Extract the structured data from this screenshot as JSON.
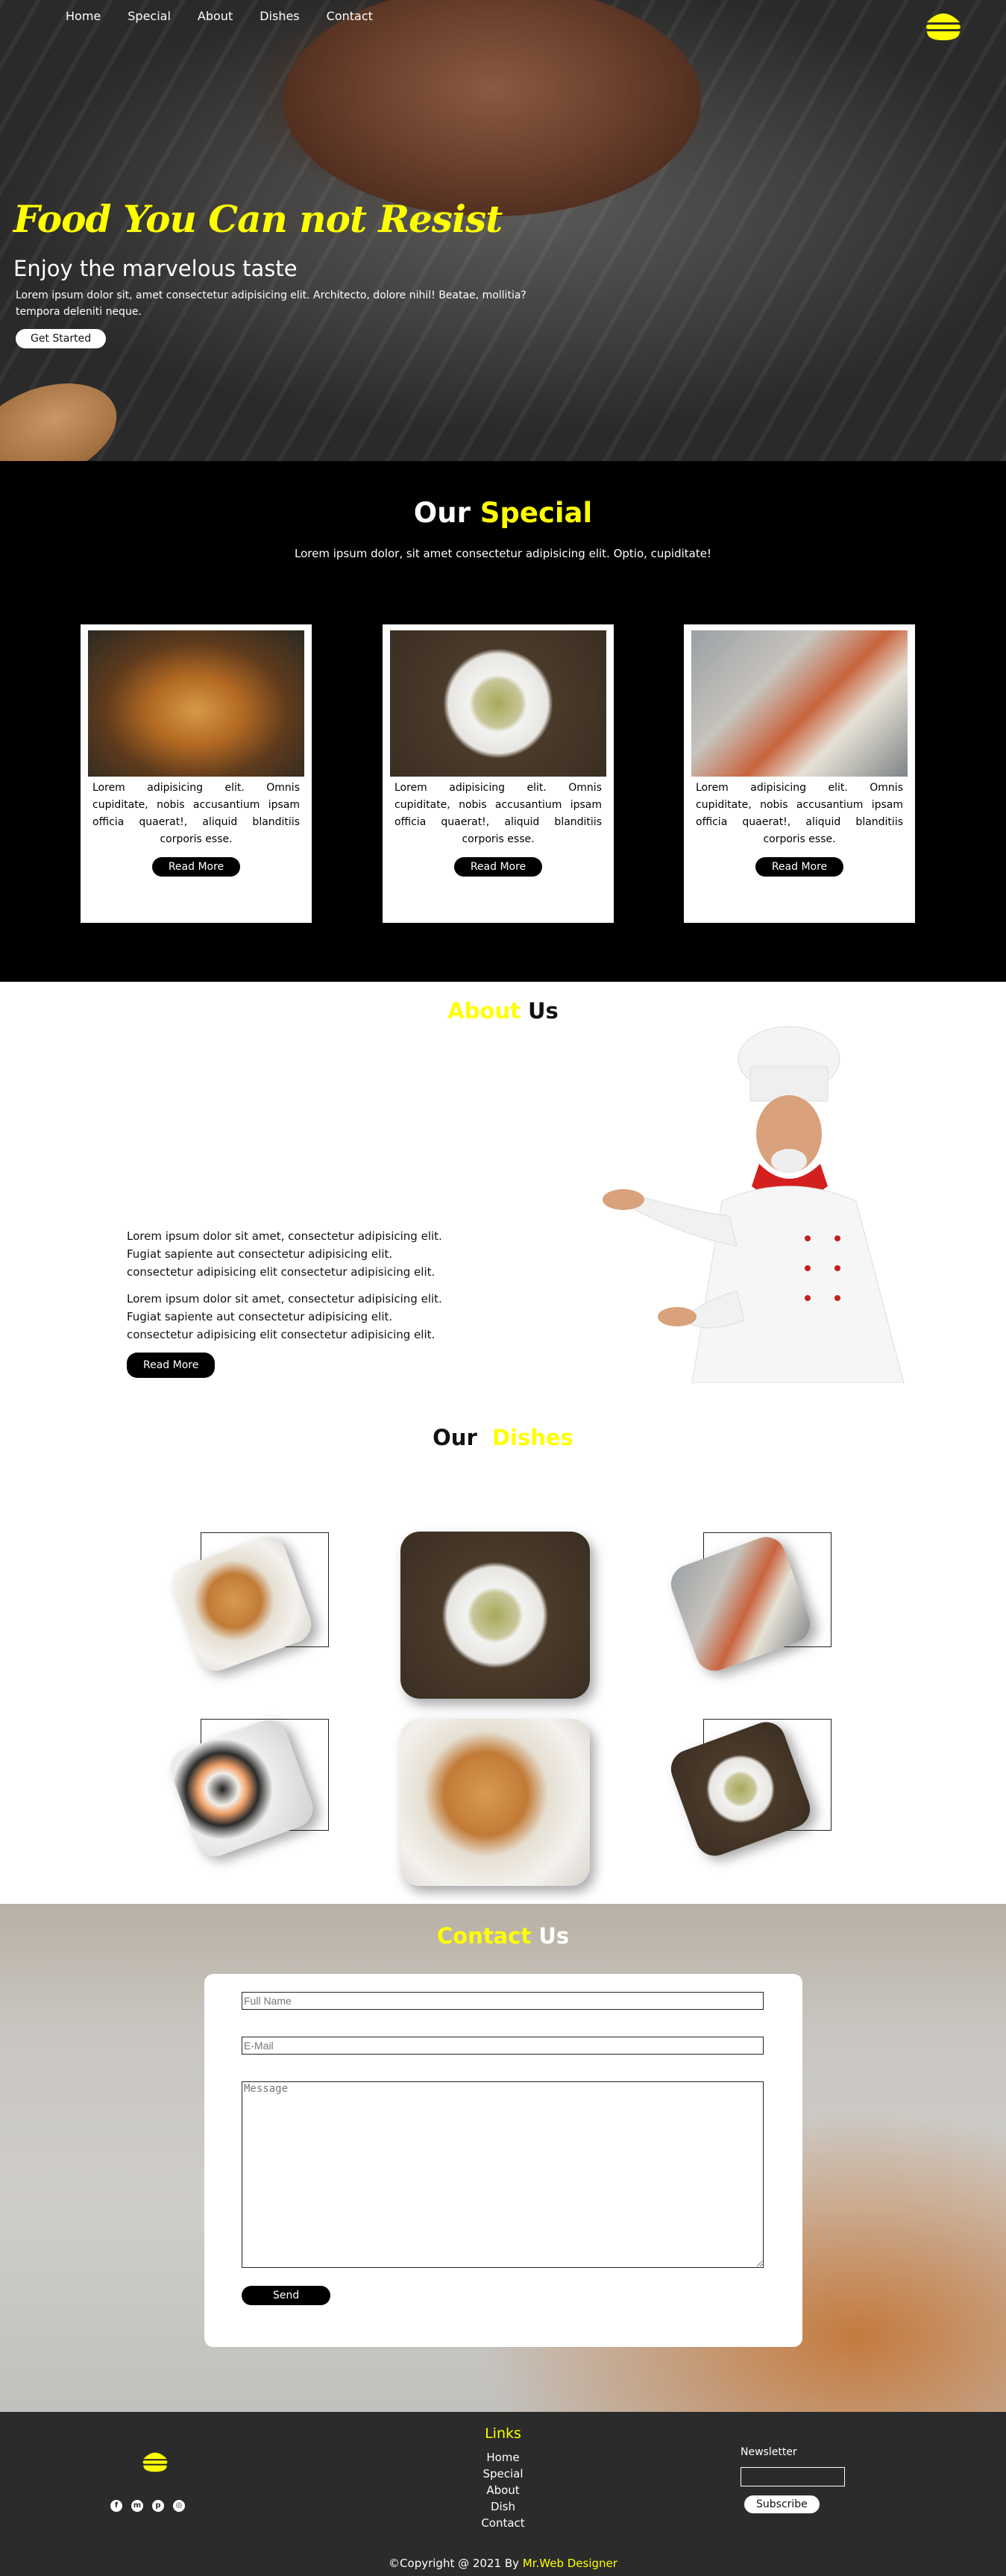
{
  "nav": {
    "items": [
      "Home",
      "Special",
      "About",
      "Dishes",
      "Contact"
    ]
  },
  "hero": {
    "title": "Food You Can not Resist",
    "subtitle": "Enjoy the marvelous taste",
    "text": "Lorem ipsum dolor sit, amet consectetur adipisicing elit. Architecto, dolore nihil! Beatae, mollitia? tempora deleniti neque.",
    "cta": "Get Started"
  },
  "special": {
    "title_a": "Our",
    "title_b": "Special",
    "description": "Lorem ipsum dolor, sit amet consectetur adipisicing elit. Optio, cupiditate!",
    "cards": [
      {
        "text": "Lorem adipisicing elit. Omnis cupiditate, nobis accusantium ipsam officia quaerat!, aliquid blanditiis corporis esse.",
        "button": "Read More",
        "image": "burger"
      },
      {
        "text": "Lorem adipisicing elit. Omnis cupiditate, nobis accusantium ipsam officia quaerat!, aliquid blanditiis corporis esse.",
        "button": "Read More",
        "image": "pasta"
      },
      {
        "text": "Lorem adipisicing elit. Omnis cupiditate, nobis accusantium ipsam officia quaerat!, aliquid blanditiis corporis esse.",
        "button": "Read More",
        "image": "tray"
      }
    ]
  },
  "about": {
    "title_a": "About",
    "title_b": "Us",
    "para1": "Lorem ipsum dolor sit amet, consectetur adipisicing elit. Fugiat sapiente aut consectetur adipisicing elit. consectetur adipisicing elit consectetur adipisicing elit.",
    "para2": "Lorem ipsum dolor sit amet, consectetur adipisicing elit. Fugiat sapiente aut consectetur adipisicing elit. consectetur adipisicing elit consectetur adipisicing elit.",
    "button": "Read More"
  },
  "dishes": {
    "title_a": "Our",
    "title_b": "Dishes"
  },
  "contact": {
    "title_a": "Contact",
    "title_b": "Us",
    "name_placeholder": "Full Name",
    "email_placeholder": "E-Mail",
    "message_placeholder": "Message",
    "send": "Send"
  },
  "footer": {
    "links_title": "Links",
    "links": [
      "Home",
      "Special",
      "About",
      "Dish",
      "Contact"
    ],
    "newsletter": "Newsletter",
    "subscribe": "Subscribe",
    "copyright": "©Copyright @ 2021 By",
    "designer": "Mr.Web Designer"
  },
  "colors": {
    "accent": "#ffff00",
    "dark": "#000000",
    "footer": "#2b2b2b"
  }
}
